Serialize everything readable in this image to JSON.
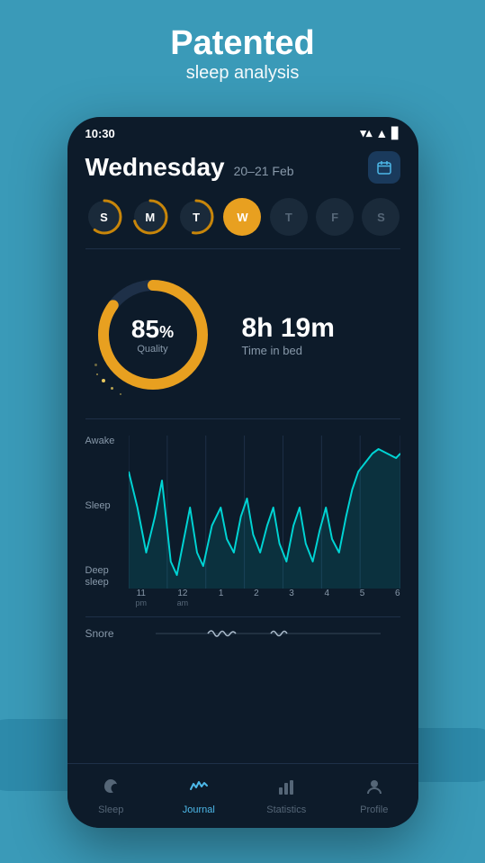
{
  "header": {
    "title": "Patented",
    "subtitle": "sleep analysis"
  },
  "statusBar": {
    "time": "10:30"
  },
  "date": {
    "day": "Wednesday",
    "range": "20–21 Feb"
  },
  "weekDays": [
    {
      "label": "S",
      "state": "ring",
      "ringColor": "#c8860a",
      "pct": 0.6
    },
    {
      "label": "M",
      "state": "ring",
      "ringColor": "#c8860a",
      "pct": 0.75
    },
    {
      "label": "T",
      "state": "ring",
      "ringColor": "#c8860a",
      "pct": 0.55
    },
    {
      "label": "W",
      "state": "active"
    },
    {
      "label": "T",
      "state": "inactive"
    },
    {
      "label": "F",
      "state": "inactive"
    },
    {
      "label": "S",
      "state": "inactive"
    }
  ],
  "sleepQuality": {
    "percent": "85",
    "percentSymbol": "%",
    "label": "Quality",
    "timeInBed": "8h 19m",
    "timeInBedLabel": "Time in bed"
  },
  "graph": {
    "yLabels": [
      "Awake",
      "Sleep",
      "Deep\nsleep"
    ],
    "xLabels": [
      {
        "main": "11",
        "sub": "pm"
      },
      {
        "main": "12",
        "sub": "am"
      },
      {
        "main": "1",
        "sub": ""
      },
      {
        "main": "2",
        "sub": ""
      },
      {
        "main": "3",
        "sub": ""
      },
      {
        "main": "4",
        "sub": ""
      },
      {
        "main": "5",
        "sub": ""
      },
      {
        "main": "6",
        "sub": ""
      }
    ]
  },
  "snore": {
    "label": "Snore"
  },
  "nav": {
    "items": [
      {
        "id": "sleep",
        "label": "Sleep",
        "icon": "moon",
        "active": false
      },
      {
        "id": "journal",
        "label": "Journal",
        "icon": "wave",
        "active": true
      },
      {
        "id": "statistics",
        "label": "Statistics",
        "icon": "bars",
        "active": false
      },
      {
        "id": "profile",
        "label": "Profile",
        "icon": "person",
        "active": false
      }
    ]
  }
}
